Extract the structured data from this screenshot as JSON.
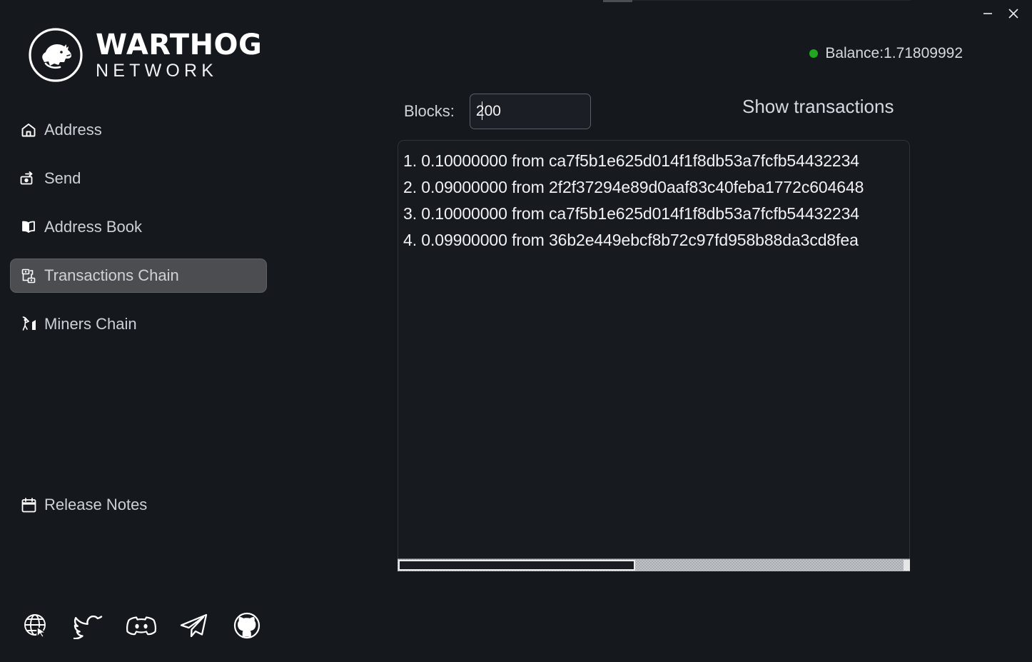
{
  "window": {
    "minimize_label": "minimize",
    "close_label": "close"
  },
  "brand": {
    "title": "WARTHOG",
    "subtitle": "NETWORK",
    "logo_icon": "warthog-head-icon"
  },
  "header": {
    "balance_text": "Balance:1.71809992",
    "status_color": "#1ea81e"
  },
  "sidebar": {
    "items": [
      {
        "label": "Address",
        "icon": "home-icon",
        "active": false
      },
      {
        "label": "Send",
        "icon": "send-money-icon",
        "active": false
      },
      {
        "label": "Address Book",
        "icon": "book-icon",
        "active": false
      },
      {
        "label": "Transactions Chain",
        "icon": "transactions-chain-icon",
        "active": true
      },
      {
        "label": "Miners Chain",
        "icon": "miner-pickaxe-icon",
        "active": false
      }
    ],
    "footer_item": {
      "label": "Release Notes",
      "icon": "calendar-icon"
    },
    "social": [
      {
        "name": "website-icon"
      },
      {
        "name": "twitter-icon"
      },
      {
        "name": "discord-icon"
      },
      {
        "name": "telegram-icon"
      },
      {
        "name": "github-icon"
      }
    ]
  },
  "main": {
    "blocks_label": "Blocks:",
    "blocks_value": "200",
    "blocks_placeholder": "",
    "show_transactions_label": "Show transactions",
    "transactions": [
      "1. 0.10000000 from ca7f5b1e625d014f1f8db53a7fcfb54432234",
      "2. 0.09000000 from 2f2f37294e89d0aaf83c40feba1772c604648",
      "3. 0.10000000 from ca7f5b1e625d014f1f8db53a7fcfb54432234",
      "4. 0.09900000 from 36b2e449ebcf8b72c97fd958b88da3cd8fea"
    ]
  }
}
